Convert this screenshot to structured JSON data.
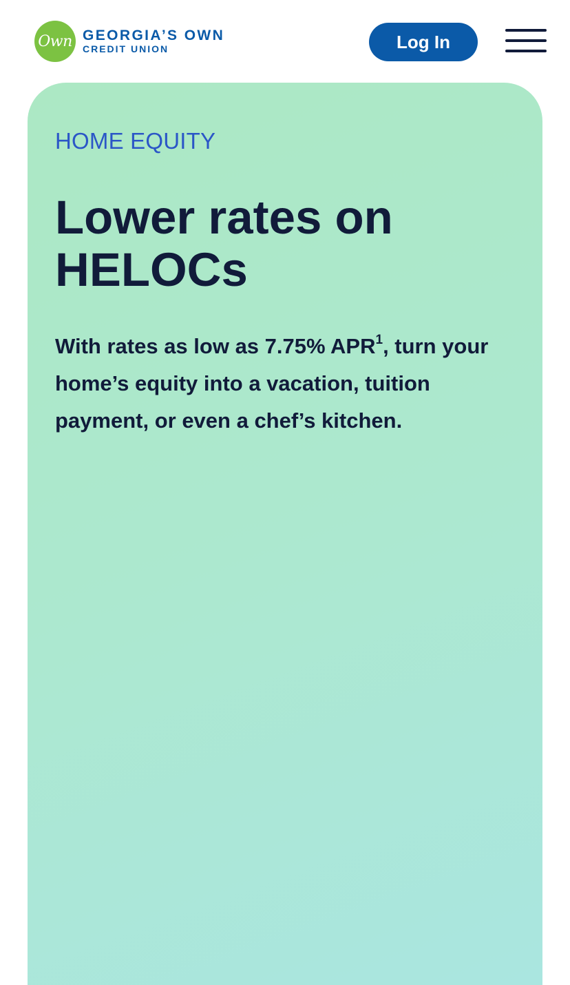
{
  "header": {
    "logo": {
      "mark_text": "Own",
      "line1": "GEORGIA’S OWN",
      "line2": "CREDIT UNION"
    },
    "login_label": "Log In",
    "menu_icon": "hamburger-icon"
  },
  "hero": {
    "eyebrow": "HOME EQUITY",
    "headline": "Lower rates on HELOCs",
    "body": {
      "before_rate": "With rates as low as ",
      "rate": "7.75% APR",
      "footnote": "1",
      "after_rate": ", turn your home’s equity into a vacation, tuition payment, or even a chef’s kitchen."
    }
  },
  "colors": {
    "brand_blue": "#0b5aa8",
    "brand_green": "#7cc242",
    "navy_text": "#111b3a",
    "eyebrow_blue": "#2b56c7",
    "hero_gradient_start": "#ace8c4",
    "hero_gradient_end": "#aae6e0"
  }
}
